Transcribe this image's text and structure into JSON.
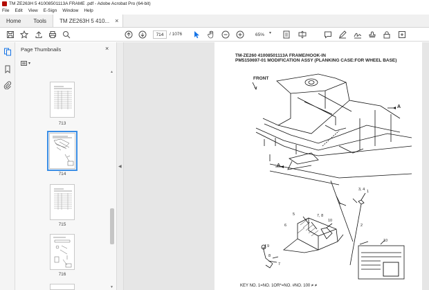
{
  "window": {
    "title": "TM ZE263H 5 41008501113A FRAME .pdf - Adobe Acrobat Pro (64-bit)"
  },
  "menu": [
    "File",
    "Edit",
    "View",
    "E-Sign",
    "Window",
    "Help"
  ],
  "tabs": {
    "home": "Home",
    "tools": "Tools",
    "document": "TM ZE263H 5 410...",
    "close": "×"
  },
  "toolbar": {
    "current_page": "714",
    "page_total": "/ 1076",
    "zoom": "65%"
  },
  "thumbnails_panel": {
    "title": "Page Thumbnails",
    "close": "×",
    "options": "▾",
    "pages": [
      "713",
      "714",
      "715",
      "716"
    ],
    "selected": "714"
  },
  "document": {
    "heading_line1": "TM-ZE260 41008501113A FRAME/HOOK-IN",
    "heading_line2": "PM5150697-01 MODIFICATION ASSY (PLANKING CASE:FOR WHEEL BASE)",
    "label_front": "FRONT",
    "label_a": "A",
    "callouts": [
      "1",
      "2",
      "3, 4",
      "5",
      "6",
      "7, 8",
      "9",
      "10",
      "7",
      "8",
      "10"
    ],
    "footer": "KEY  NO.  1=NO.  1OR*=NO.  #NO.  100 ≠ ≠"
  },
  "colors": {
    "accent": "#1473e6",
    "brand": "#b30b00"
  }
}
